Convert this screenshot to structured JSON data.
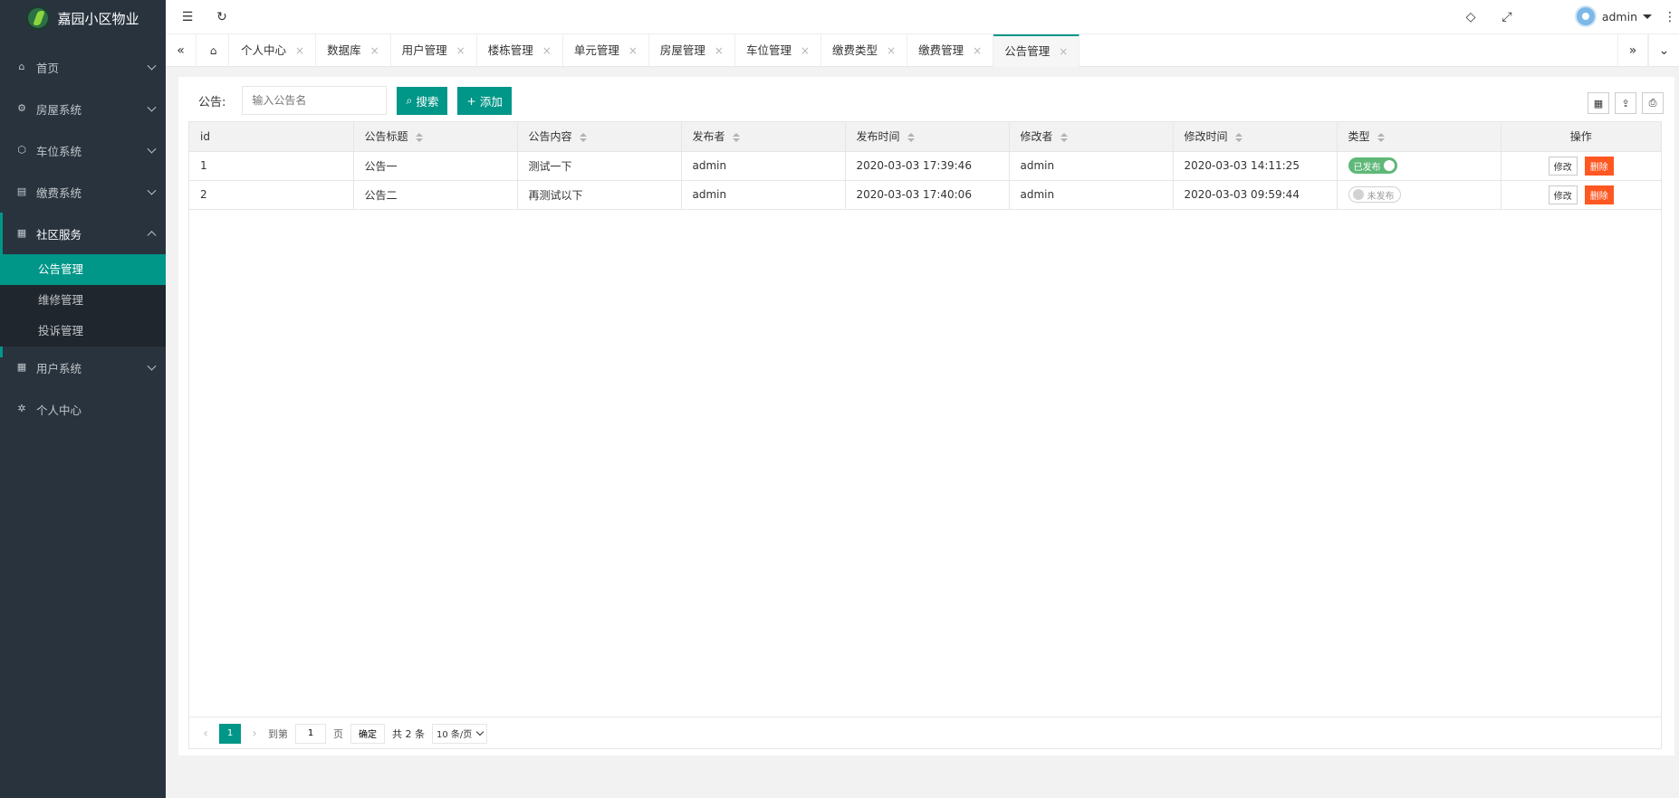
{
  "app": {
    "title": "嘉园小区物业"
  },
  "sidebar": {
    "items": [
      {
        "label": "首页",
        "icon": "home-icon"
      },
      {
        "label": "房屋系统",
        "icon": "gear-icon"
      },
      {
        "label": "车位系统",
        "icon": "cube-icon"
      },
      {
        "label": "缴费系统",
        "icon": "list-icon"
      },
      {
        "label": "社区服务",
        "icon": "apps-icon"
      },
      {
        "label": "用户系统",
        "icon": "apps-icon"
      },
      {
        "label": "个人中心",
        "icon": "chip-icon"
      }
    ],
    "sub_items": [
      {
        "label": "公告管理"
      },
      {
        "label": "维修管理"
      },
      {
        "label": "投诉管理"
      }
    ]
  },
  "header": {
    "user": "admin"
  },
  "tabs": [
    {
      "label": "个人中心"
    },
    {
      "label": "数据库"
    },
    {
      "label": "用户管理"
    },
    {
      "label": "楼栋管理"
    },
    {
      "label": "单元管理"
    },
    {
      "label": "房屋管理"
    },
    {
      "label": "车位管理"
    },
    {
      "label": "缴费类型"
    },
    {
      "label": "缴费管理"
    },
    {
      "label": "公告管理"
    }
  ],
  "search": {
    "label": "公告:",
    "placeholder": "输入公告名",
    "search_button": "搜索",
    "add_button": "添加"
  },
  "table": {
    "columns": [
      "id",
      "公告标题",
      "公告内容",
      "发布者",
      "发布时间",
      "修改者",
      "修改时间",
      "类型",
      "操作"
    ],
    "rows": [
      {
        "id": "1",
        "title": "公告一",
        "content": "测试一下",
        "publisher": "admin",
        "publish_time": "2020-03-03 17:39:46",
        "modifier": "admin",
        "modify_time": "2020-03-03 14:11:25",
        "status": "已发布",
        "edit": "修改",
        "delete": "删除"
      },
      {
        "id": "2",
        "title": "公告二",
        "content": "再测试以下",
        "publisher": "admin",
        "publish_time": "2020-03-03 17:40:06",
        "modifier": "admin",
        "modify_time": "2020-03-03 09:59:44",
        "status": "未发布",
        "edit": "修改",
        "delete": "删除"
      }
    ]
  },
  "pager": {
    "current": "1",
    "goto_label": "到第",
    "page_value": "1",
    "page_unit": "页",
    "confirm": "确定",
    "total": "共 2 条",
    "page_size": "10 条/页"
  },
  "colors": {
    "primary": "#009688",
    "sidebar": "#28333e",
    "danger": "#ff5722",
    "switch_on": "#5fb878"
  }
}
